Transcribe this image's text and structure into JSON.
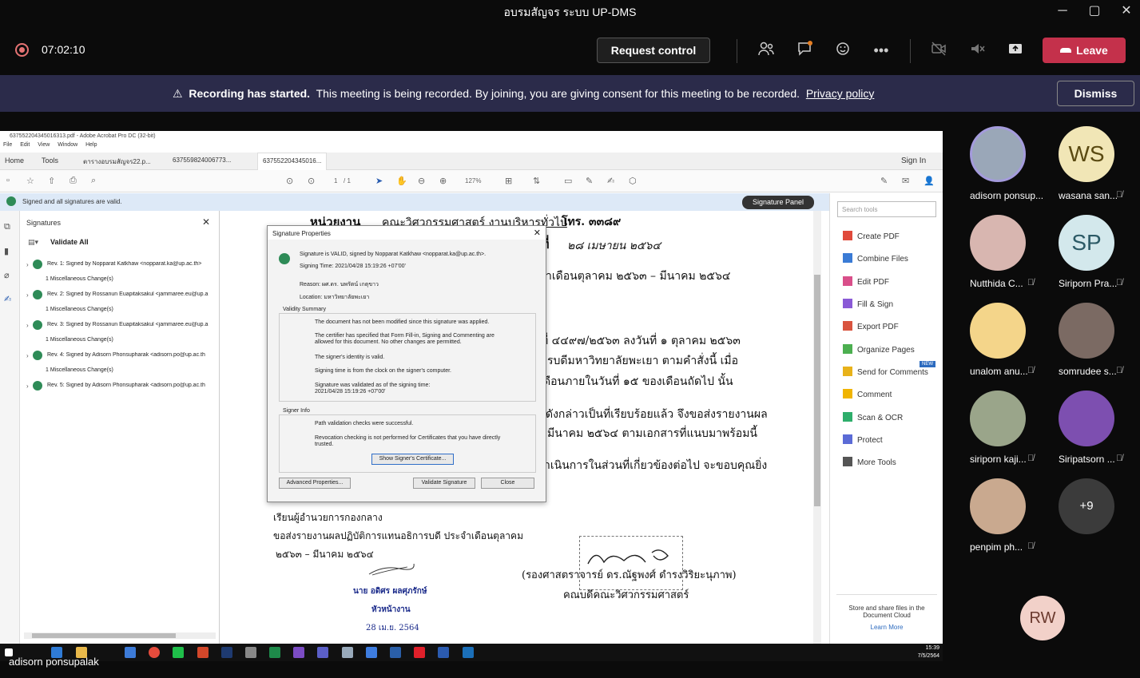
{
  "window": {
    "title": "อบรมสัญจร ระบบ UP-DMS",
    "min": "─",
    "max": "▢",
    "close": "✕"
  },
  "meeting": {
    "timer": "07:02:10",
    "request_control": "Request control",
    "leave": "Leave",
    "icons": [
      "participants-icon",
      "chat-icon",
      "reactions-icon",
      "more-icon",
      "camera-off-icon",
      "mic-off-icon",
      "share-icon"
    ]
  },
  "banner": {
    "bold": "Recording has started.",
    "text": "This meeting is being recorded. By joining, you are giving consent for this meeting to be recorded.",
    "link": "Privacy policy",
    "dismiss": "Dismiss"
  },
  "acrobat": {
    "title": "637552204345016313.pdf - Adobe Acrobat Pro DC (32-bit)",
    "menu": [
      "File",
      "Edit",
      "View",
      "Window",
      "Help"
    ],
    "home": "Home",
    "tools": "Tools",
    "tabs": [
      "ตารางอบรมสัญจร22.p...",
      "637559824006773...",
      "637552204345016..."
    ],
    "sign_in": "Sign In",
    "page": "1",
    "page_total": "/ 1",
    "zoom": "127%",
    "sig_status": "Signed and all signatures are valid.",
    "sig_panel_btn": "Signature Panel"
  },
  "signatures": {
    "title": "Signatures",
    "validate_all": "Validate All",
    "revs": [
      {
        "label": "Rev. 1: Signed by Nopparat Katkhaw <nopparat.ka@up.ac.th>",
        "change": "1 Miscellaneous Change(s)"
      },
      {
        "label": "Rev. 2: Signed by Rossanun Euapitaksakul <jammaree.eu@up.a",
        "change": "1 Miscellaneous Change(s)"
      },
      {
        "label": "Rev. 3: Signed by Rossanun Euapitaksakul <jammaree.eu@up.a",
        "change": "1 Miscellaneous Change(s)"
      },
      {
        "label": "Rev. 4: Signed by Adisorn Phonsupharak <adisorn.po@up.ac.th",
        "change": "1 Miscellaneous Change(s)"
      },
      {
        "label": "Rev. 5: Signed by Adisorn Phonsupharak <adisorn.po@up.ac.th",
        "change": ""
      }
    ]
  },
  "dialog": {
    "title": "Signature Properties",
    "status": "Signature is VALID, signed by Nopparat Katkhaw <nopparat.ka@up.ac.th>.",
    "signing_time": "Signing Time:  2021/04/28 15:19:26 +07'00'",
    "reason": "Reason:  ผศ.ดร. นพรัตน์ เกตุขาว",
    "location": "Location:  มหาวิทยาลัยพะเยา",
    "validity_title": "Validity Summary",
    "v1": "The document has not been modified since this signature was applied.",
    "v2a": "The certifier has specified that Form Fill-in, Signing and Commenting are",
    "v2b": "allowed for this document. No other changes are permitted.",
    "v3": "The signer's identity is valid.",
    "v4": "Signing time is from the clock on the signer's computer.",
    "v5a": "Signature was validated as of the signing time:",
    "v5b": "2021/04/28 15:19:26 +07'00'",
    "signer_title": "Signer Info",
    "s1": "Path validation checks were successful.",
    "s2a": "Revocation checking is not performed for Certificates that you have directly",
    "s2b": "trusted.",
    "show_cert": "Show Signer's Certificate...",
    "advanced": "Advanced Properties...",
    "validate": "Validate Signature",
    "close": "Close"
  },
  "document": {
    "l1a": "หน่วยงาน",
    "l1b": "คณะวิศวกรรมศาสตร์ งานบริหารทั่วไป",
    "l1c": "โทร. ๓๓๘๙",
    "l2": "๒๘ เมษายน ๒๕๖๔",
    "l2b": "ที่",
    "l3": "ำเดือนตุลาคม ๒๕๖๓ – มีนาคม ๒๕๖๔",
    "l4": "ที่ ๔๔๙๗/๒๕๖๓ ลงวันที่ ๑ ตุลาคม ๒๕๖๓",
    "l5": "รบดีมหาวิทยาลัยพะเยา ตามคำสั่งนี้          เมื่อ",
    "l6": "ดือนภายในวันที่ ๑๕ ของเดือนถัดไป นั้น",
    "l7": "ดังกล่าวเป็นที่เรียบร้อยแล้ว จึงขอส่งรายงานผล",
    "l8": "มีนาคม ๒๕๖๔ ตามเอกสารที่แนบมาพร้อมนี้",
    "l9": "ำเนินการในส่วนที่เกี่ยวข้องต่อไป จะขอบคุณยิ่ง",
    "l10": "เรียนผู้อำนวยการกองกลาง",
    "l11": "ขอส่งรายงานผลปฏิบัติการแทนอธิการบดี ประจำเดือนตุลาคม",
    "l12": "๒๕๖๓ – มีนาคม ๒๕๖๔",
    "l13": "นาย อดิศร ผลศุภรักษ์",
    "l14": "หัวหน้างาน",
    "l15": "28 เม.ย. 2564",
    "l16": "(รองศาสตราจารย์ ดร.ณัฐพงศ์ ดำรงวิริยะนุภาพ)",
    "l17": "คณบดีคณะวิศวกรรมศาสตร์"
  },
  "tools_pane": {
    "search_placeholder": "Search tools",
    "items": [
      "Create PDF",
      "Combine Files",
      "Edit PDF",
      "Fill & Sign",
      "Export PDF",
      "Organize Pages",
      "Send for Comments",
      "Comment",
      "Scan & OCR",
      "Protect",
      "More Tools"
    ],
    "new_badge": "NEW",
    "promo": "Store and share files in the Document Cloud",
    "learn_more": "Learn More",
    "colors": [
      "#e04a3b",
      "#3a7bd5",
      "#d94f8a",
      "#8a5ad6",
      "#d9543f",
      "#4caf50",
      "#e8b21a",
      "#f0b400",
      "#2eae6b",
      "#5b6bd6",
      "#555555"
    ]
  },
  "taskbar": {
    "time": "15:39",
    "date": "7/5/2564"
  },
  "presenter_name": "adisorn ponsupalak",
  "gallery": {
    "participants": [
      {
        "name": "adisorn ponsup...",
        "initials": "",
        "color": "#9aa7b8",
        "muted": false
      },
      {
        "name": "wasana san...",
        "initials": "WS",
        "color": "#f1e6b6",
        "fg": "#5a4a12",
        "muted": true
      },
      {
        "name": "Nutthida C...",
        "initials": "",
        "color": "#d8b6b0",
        "muted": true
      },
      {
        "name": "Siriporn Pra...",
        "initials": "SP",
        "color": "#d3e8ec",
        "fg": "#2c5a66",
        "muted": true
      },
      {
        "name": "unalom anu...",
        "initials": "",
        "color": "#f4d58a",
        "muted": true
      },
      {
        "name": "somrudee s...",
        "initials": "",
        "color": "#7b6a63",
        "muted": true
      },
      {
        "name": "siriporn kaji...",
        "initials": "",
        "color": "#9aa58a",
        "muted": true
      },
      {
        "name": "Siripatsorn ...",
        "initials": "",
        "color": "#7d4fb0",
        "muted": true
      },
      {
        "name": "penpim ph...",
        "initials": "",
        "color": "#c9a98f",
        "muted": true
      }
    ],
    "overflow": "+9",
    "self_initials": "RW"
  }
}
